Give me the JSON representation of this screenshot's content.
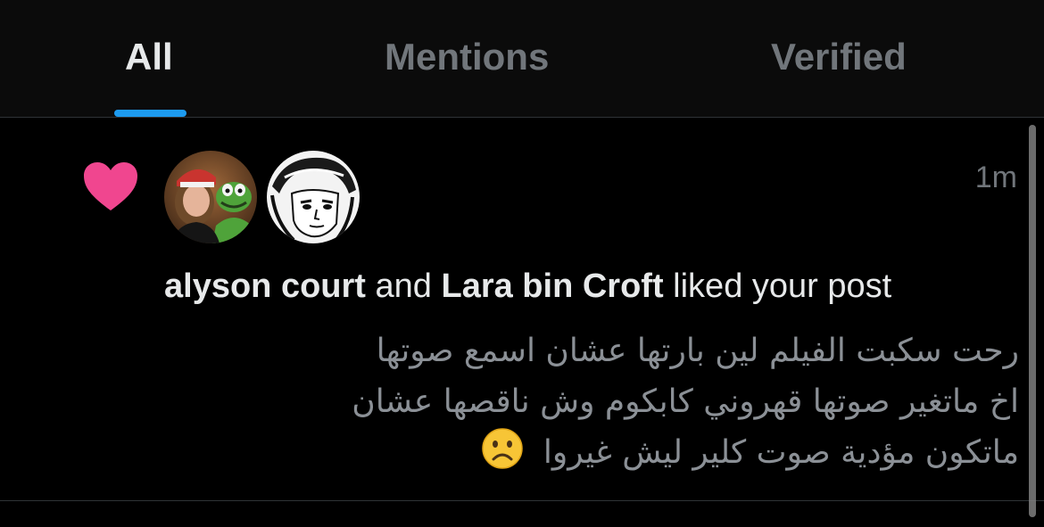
{
  "tabs": [
    {
      "label": "All",
      "active": true
    },
    {
      "label": "Mentions",
      "active": false
    },
    {
      "label": "Verified",
      "active": false
    }
  ],
  "notification": {
    "icon": "heart-icon",
    "icon_color": "#f0468f",
    "timestamp": "1m",
    "user_1": "alyson court",
    "connector": "and",
    "user_2": "Lara bin Croft",
    "action": "liked your post",
    "post_lines": [
      "رحت سكبت الفيلم لين بارتها عشان اسمع صوتها",
      "اخ ماتغير صوتها قهروني كابكوم وش ناقصها عشان",
      "ماتكون مؤدية صوت كلير ليش غيروا"
    ],
    "post_emoji": "☹️"
  },
  "colors": {
    "accent": "#1d9bf0",
    "background": "#000000",
    "muted_text": "#71767b"
  }
}
